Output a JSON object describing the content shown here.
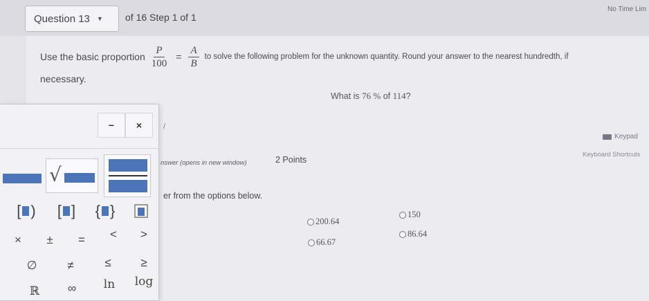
{
  "header": {
    "question_label": "Question 13",
    "step_text": "of 16 Step 1 of 1",
    "time_limit": "No Time Lim"
  },
  "instruction": {
    "prefix": "Use the basic proportion",
    "frac1_num": "P",
    "frac1_den": "100",
    "equals": "=",
    "frac2_num": "A",
    "frac2_den": "B",
    "suffix": "to solve the following problem for the unknown quantity. Round your answer to the nearest hundredth, if",
    "line2": "necessary."
  },
  "question": {
    "prefix": "What is ",
    "percent": "76 %",
    "middle": " of ",
    "number": "114",
    "suffix": "?"
  },
  "tools": {
    "keypad_label": "Keypad",
    "shortcuts_label": "Keyboard Shortcuts"
  },
  "answer": {
    "link_text": "nswer (opens in new window)",
    "points": "2 Points",
    "options_instruction": "er from the options below.",
    "options": [
      "200.64",
      "150",
      "66.67",
      "86.64"
    ]
  },
  "math_panel": {
    "minimize_label": "−",
    "close_label": "×",
    "row1": [
      "[■)",
      "[■]",
      "{■}",
      "▥"
    ],
    "row2": [
      "×",
      "±",
      "=",
      "<",
      ">"
    ],
    "row3": [
      "∅",
      "≠",
      "≤",
      "≥"
    ],
    "row4": [
      "ℝ",
      "∞",
      "ln",
      "log"
    ]
  },
  "colors": {
    "accent_blue": "#4c74b8",
    "page_bg": "#ecebf0"
  }
}
